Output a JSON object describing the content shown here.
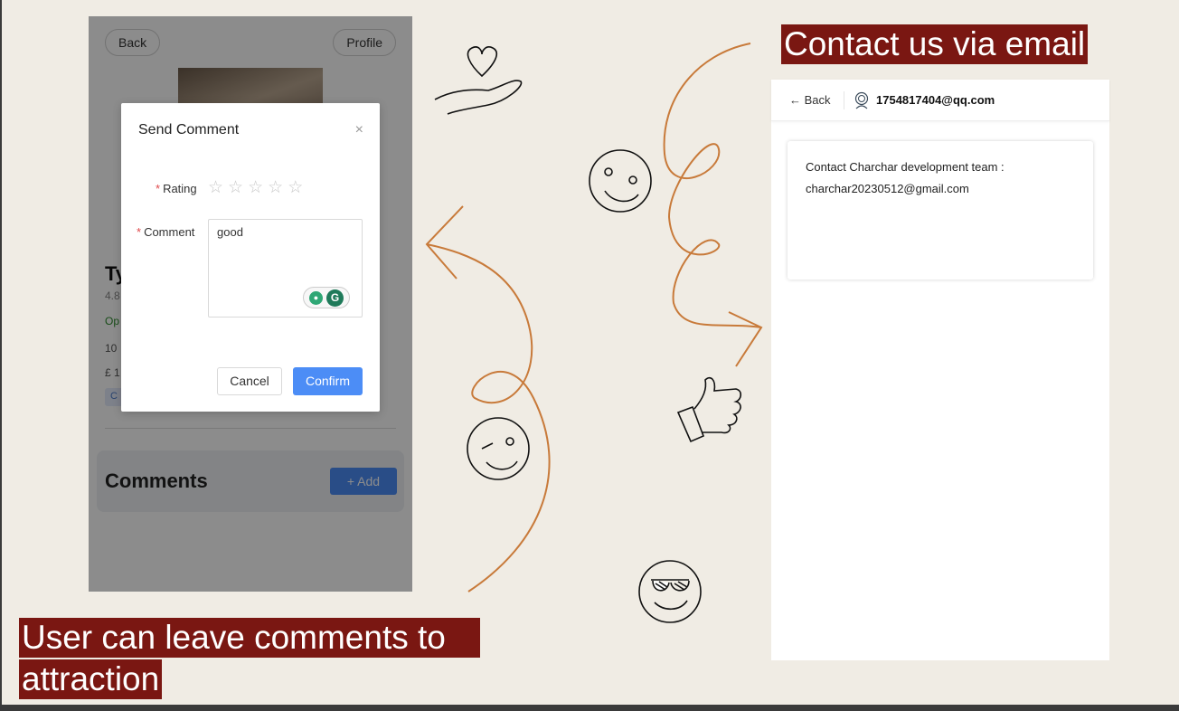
{
  "captions": {
    "email": "Contact us via email",
    "comments_line1": "User can leave comments to",
    "comments_line2": "attraction"
  },
  "left_app": {
    "back_label": "Back",
    "profile_label": "Profile",
    "attraction_title_partial": "Ty",
    "rating_partial": "4.8",
    "status_partial": "Op",
    "hours_partial": "10",
    "price_partial": "£ 1",
    "tag_partial": "C",
    "comments_heading": "Comments",
    "add_button": "+ Add",
    "modal": {
      "title": "Send Comment",
      "close": "×",
      "required_mark": "*",
      "rating_label": "Rating",
      "rating_stars": 5,
      "rating_value": 0,
      "star_glyph": "☆",
      "comment_label": "Comment",
      "comment_value": "good",
      "cancel_label": "Cancel",
      "confirm_label": "Confirm"
    }
  },
  "right_app": {
    "back_label": "← Back",
    "account_email": "1754817404@qq.com",
    "contact_line1": "Contact Charchar development team :",
    "contact_line2": "charchar20230512@gmail.com"
  },
  "colors": {
    "background": "#f0ece4",
    "caption_bg": "#7a1712",
    "primary_blue": "#4c8df6",
    "doodle_orange": "#c87a3a"
  },
  "icons": [
    "heart-hand-icon",
    "smiley-icon",
    "wink-icon",
    "thumbs-up-icon",
    "sunglasses-icon",
    "avatar-icon"
  ]
}
